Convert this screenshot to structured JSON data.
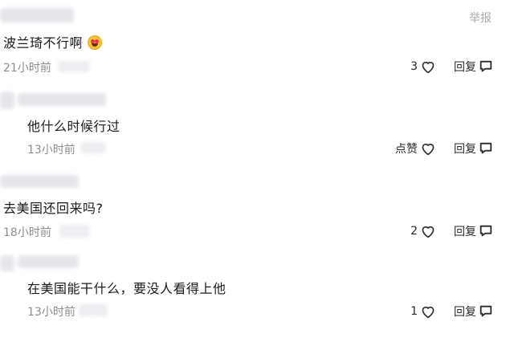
{
  "report_label": "举报",
  "reply_label": "回复",
  "comments": [
    {
      "text": "波兰琦不行啊",
      "emoji": "heart-eyes-emoji",
      "time": "21小时前",
      "like": "3"
    },
    {
      "text": "他什么时候行过",
      "time": "13小时前",
      "like": "点赞"
    },
    {
      "text": "去美国还回来吗?",
      "time": "18小时前",
      "like": "2"
    },
    {
      "text": "在美国能干什么，要没人看得上他",
      "time": "13小时前",
      "like": "1"
    }
  ]
}
